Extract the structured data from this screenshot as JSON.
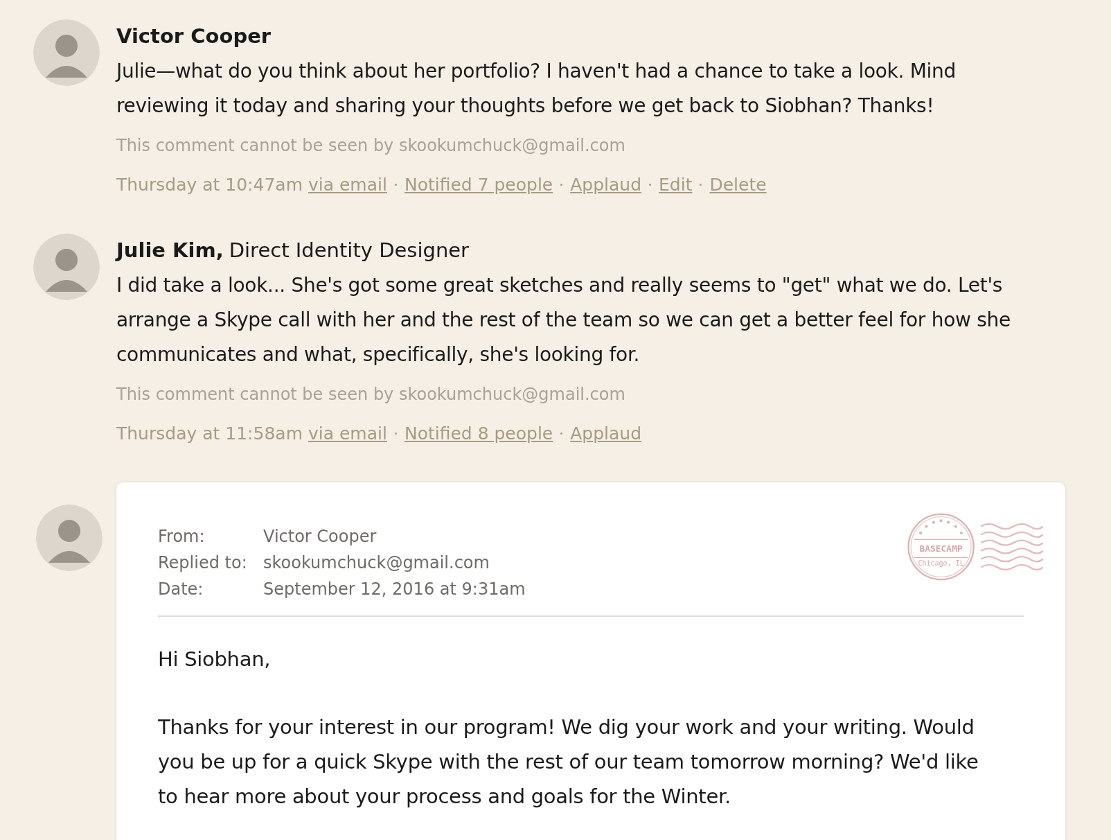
{
  "comments": [
    {
      "author": "Victor Cooper",
      "body": "Julie—what do you think about her portfolio? I haven't had a chance to take a look. Mind reviewing it today and sharing your thoughts before we get back to Siobhan? Thanks!",
      "visibility_note": "This comment cannot be seen by skookumchuck@gmail.com",
      "time": "Thursday at 10:47am",
      "actions": [
        "via email",
        "Notified 7 people",
        "Applaud",
        "Edit",
        "Delete"
      ]
    },
    {
      "author": "Julie Kim,",
      "role": "Direct Identity Designer",
      "body": "I did take a look... She's got some great sketches and really seems to \"get\" what we do. Let's arrange a Skype call with her and the rest of the team so we can get a better feel for how she communicates and what, specifically, she's looking for.",
      "visibility_note": "This comment cannot be seen by skookumchuck@gmail.com",
      "time": "Thursday at 11:58am",
      "actions": [
        "via email",
        "Notified 8 people",
        "Applaud"
      ]
    }
  ],
  "email": {
    "fields": [
      {
        "label": "From:",
        "value": "Victor Cooper"
      },
      {
        "label": "Replied to:",
        "value": "skookumchuck@gmail.com"
      },
      {
        "label": "Date:",
        "value": "September 12, 2016 at 9:31am"
      }
    ],
    "stamp": {
      "name": "BASECAMP",
      "place": "Chicago, IL"
    },
    "greeting": "Hi Siobhan,",
    "paragraphs": [
      "Thanks for your interest in our program! We dig your work and your writing. Would you be up for a quick Skype with the rest of our team tomorrow morning? We'd like to hear more about your process and goals for the Winter."
    ]
  }
}
